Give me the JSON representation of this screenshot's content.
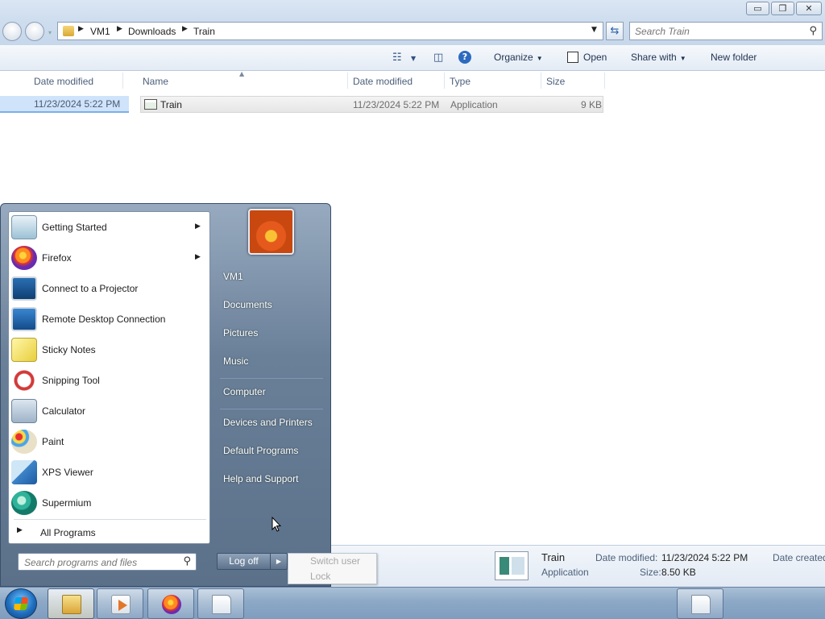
{
  "window": {
    "caption": {
      "minimize": "▭",
      "maximize": "❐",
      "close": "✕"
    },
    "nav": {
      "back_icon": "back-arrow-icon",
      "forward_icon": "forward-arrow-icon"
    },
    "breadcrumb": [
      "VM1",
      "Downloads",
      "Train"
    ],
    "search_placeholder": "Search Train"
  },
  "toolbar": {
    "organize": "Organize",
    "open": "Open",
    "share_with": "Share with",
    "new_folder": "New folder"
  },
  "columns": {
    "left_date_modified": "Date modified",
    "name": "Name",
    "date_modified": "Date modified",
    "type": "Type",
    "size": "Size"
  },
  "left_selection": {
    "date": "11/23/2024 5:22 PM"
  },
  "files": [
    {
      "name": "Train",
      "date_modified": "11/23/2024 5:22 PM",
      "type": "Application",
      "size": "9 KB"
    }
  ],
  "details": {
    "name": "Train",
    "type": "Application",
    "date_modified_label": "Date modified:",
    "date_modified_value": "11/23/2024 5:22 PM",
    "size_label": "Size:",
    "size_value": "8.50 KB",
    "date_created_label": "Date created"
  },
  "start_menu": {
    "programs": [
      {
        "label": "Getting Started",
        "submenu": true,
        "icon": "getting-started-icon"
      },
      {
        "label": "Firefox",
        "submenu": true,
        "icon": "firefox-icon"
      },
      {
        "label": "Connect to a Projector",
        "submenu": false,
        "icon": "projector-icon"
      },
      {
        "label": "Remote Desktop Connection",
        "submenu": false,
        "icon": "remote-desktop-icon"
      },
      {
        "label": "Sticky Notes",
        "submenu": false,
        "icon": "sticky-notes-icon"
      },
      {
        "label": "Snipping Tool",
        "submenu": false,
        "icon": "snipping-tool-icon"
      },
      {
        "label": "Calculator",
        "submenu": false,
        "icon": "calculator-icon"
      },
      {
        "label": "Paint",
        "submenu": false,
        "icon": "paint-icon"
      },
      {
        "label": "XPS Viewer",
        "submenu": false,
        "icon": "xps-viewer-icon"
      },
      {
        "label": "Supermium",
        "submenu": false,
        "icon": "supermium-icon"
      }
    ],
    "all_programs": "All Programs",
    "search_placeholder": "Search programs and files",
    "right_items": [
      "VM1",
      "Documents",
      "Pictures",
      "Music",
      "Computer",
      "Devices and Printers",
      "Default Programs",
      "Help and Support"
    ],
    "shutdown_label": "Log off",
    "power_menu": [
      "Switch user",
      "Lock"
    ]
  },
  "colors": {
    "taskbar": "#8ca8c6",
    "start_menu": "#6a8099",
    "selection": "#cfe3fa"
  }
}
